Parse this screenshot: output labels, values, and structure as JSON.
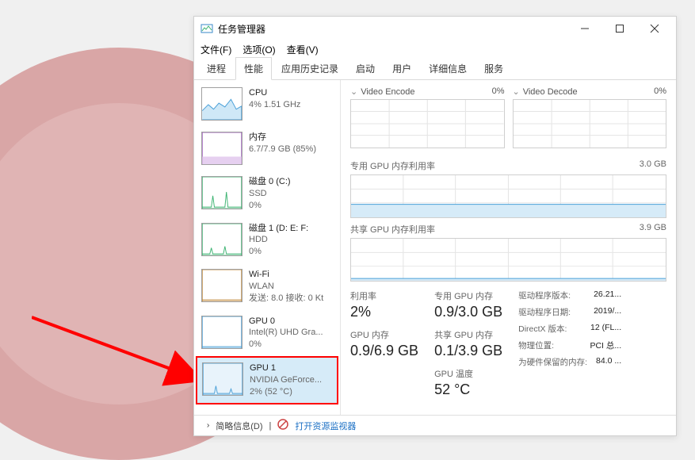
{
  "window": {
    "title": "任务管理器",
    "min": "—",
    "max": "□",
    "close": "×"
  },
  "menu": [
    "文件(F)",
    "选项(O)",
    "查看(V)"
  ],
  "tabs": [
    "进程",
    "性能",
    "应用历史记录",
    "启动",
    "用户",
    "详细信息",
    "服务"
  ],
  "activeTab": 1,
  "sidebar": [
    {
      "title": "CPU",
      "sub1": "4% 1.51 GHz",
      "sub2": "",
      "color": "#4aa0d8",
      "selected": false
    },
    {
      "title": "内存",
      "sub1": "6.7/7.9 GB (85%)",
      "sub2": "",
      "color": "#a05bc0",
      "selected": false
    },
    {
      "title": "磁盘 0 (C:)",
      "sub1": "SSD",
      "sub2": "0%",
      "color": "#3cb371",
      "selected": false
    },
    {
      "title": "磁盘 1 (D: E: F:",
      "sub1": "HDD",
      "sub2": "0%",
      "color": "#3cb371",
      "selected": false
    },
    {
      "title": "Wi-Fi",
      "sub1": "WLAN",
      "sub2": "发送: 8.0 接收: 0 Kt",
      "color": "#c08a3c",
      "selected": false
    },
    {
      "title": "GPU 0",
      "sub1": "Intel(R) UHD Gra...",
      "sub2": "0%",
      "color": "#4aa0d8",
      "selected": false
    },
    {
      "title": "GPU 1",
      "sub1": "NVIDIA GeForce...",
      "sub2": "2% (52 °C)",
      "color": "#4aa0d8",
      "selected": true
    }
  ],
  "detail": {
    "chart1_label": "Video Encode",
    "chart1_pct": "0%",
    "chart2_label": "Video Decode",
    "chart2_pct": "0%",
    "mem1_label": "专用 GPU 内存利用率",
    "mem1_max": "3.0 GB",
    "mem2_label": "共享 GPU 内存利用率",
    "mem2_max": "3.9 GB",
    "stats": {
      "util_lbl": "利用率",
      "util_val": "2%",
      "gpumem_lbl": "GPU 内存",
      "gpumem_val": "0.9/6.9 GB",
      "dedmem_lbl": "专用 GPU 内存",
      "dedmem_val": "0.9/3.0 GB",
      "shrmem_lbl": "共享 GPU 内存",
      "shrmem_val": "0.1/3.9 GB",
      "temp_lbl": "GPU 温度",
      "temp_val": "52 °C"
    },
    "info": [
      {
        "k": "驱动程序版本:",
        "v": "26.21..."
      },
      {
        "k": "驱动程序日期:",
        "v": "2019/..."
      },
      {
        "k": "DirectX 版本:",
        "v": "12 (FL..."
      },
      {
        "k": "物理位置:",
        "v": "PCI 总..."
      },
      {
        "k": "为硬件保留的内存:",
        "v": "84.0 ..."
      }
    ]
  },
  "statusbar": {
    "brief": "简略信息(D)",
    "link": "打开资源监视器"
  },
  "chart_data": [
    {
      "type": "line",
      "title": "Video Encode",
      "ylim": [
        0,
        100
      ],
      "values": [
        0,
        0,
        0,
        0,
        0,
        0,
        0,
        0,
        0,
        0
      ]
    },
    {
      "type": "line",
      "title": "Video Decode",
      "ylim": [
        0,
        100
      ],
      "values": [
        0,
        0,
        0,
        0,
        0,
        0,
        0,
        0,
        0,
        0
      ]
    },
    {
      "type": "area",
      "title": "专用 GPU 内存利用率",
      "ylim": [
        0,
        3.0
      ],
      "unit": "GB",
      "values": [
        0.9,
        0.9,
        0.9,
        0.9,
        0.9,
        0.9,
        0.9,
        0.9,
        0.9,
        0.9
      ]
    },
    {
      "type": "area",
      "title": "共享 GPU 内存利用率",
      "ylim": [
        0,
        3.9
      ],
      "unit": "GB",
      "values": [
        0.1,
        0.1,
        0.1,
        0.1,
        0.1,
        0.1,
        0.1,
        0.1,
        0.1,
        0.1
      ]
    }
  ]
}
